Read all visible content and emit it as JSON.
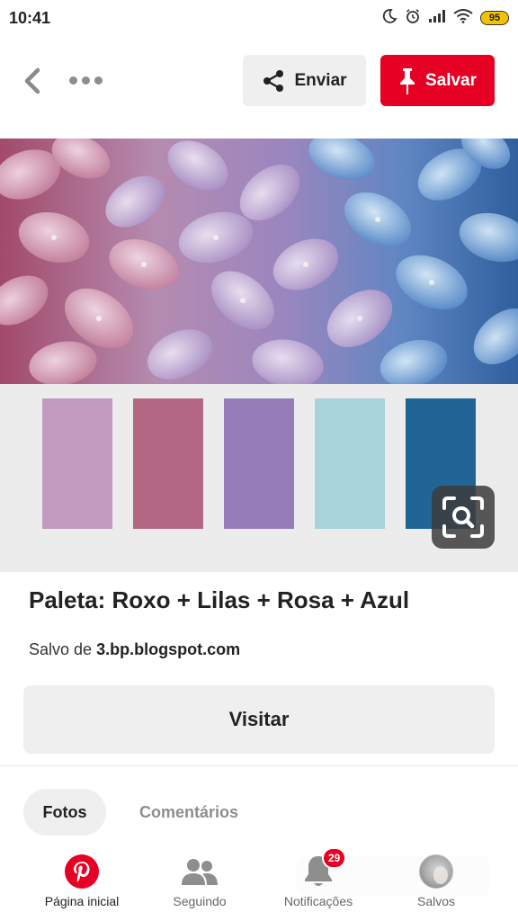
{
  "status_bar": {
    "time": "10:41",
    "battery": "95",
    "icons": [
      "moon-icon",
      "alarm-icon",
      "signal-icon",
      "wifi-icon",
      "battery-icon"
    ]
  },
  "header": {
    "send_label": "Enviar",
    "save_label": "Salvar",
    "save_color": "#e60023"
  },
  "pin": {
    "palette": [
      "#c29ac0",
      "#b46883",
      "#967cb9",
      "#a9d3db",
      "#206596"
    ],
    "title": "Paleta: Roxo + Lilas + Rosa + Azul",
    "saved_prefix": "Salvo de",
    "saved_source": "3.bp.blogspot.com",
    "visit_label": "Visitar"
  },
  "tabs": [
    {
      "label": "Fotos",
      "active": true
    },
    {
      "label": "Comentários",
      "active": false
    }
  ],
  "bottom_nav": [
    {
      "label": "Página inicial",
      "icon": "pinterest-logo-icon",
      "active": true
    },
    {
      "label": "Seguindo",
      "icon": "people-icon",
      "active": false
    },
    {
      "label": "Notificações",
      "icon": "bell-icon",
      "badge": "29",
      "active": false
    },
    {
      "label": "Salvos",
      "icon": "avatar",
      "active": false
    }
  ]
}
